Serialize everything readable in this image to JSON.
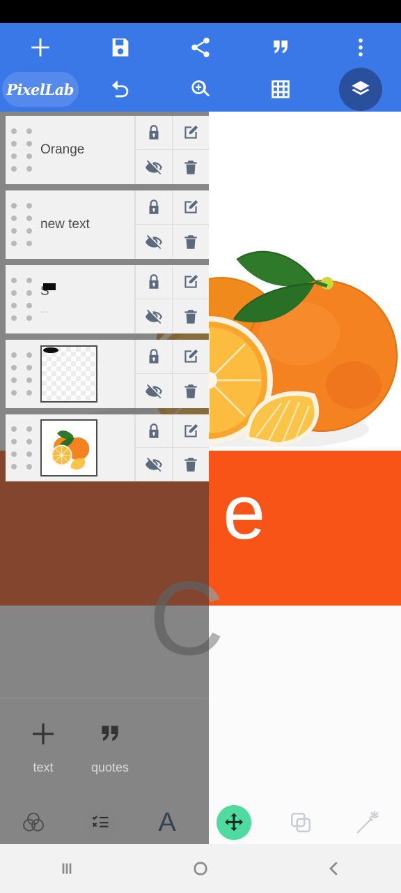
{
  "app": {
    "name": "PixelLab",
    "logo_text": "PixelLab"
  },
  "colors": {
    "appbar_blue": "#3b78e7",
    "logo_pill_blue": "#5689ec",
    "layers_fab_navy": "#2a4f9b",
    "canvas_orange": "#f95418",
    "panel_overlay": "rgba(60,60,60,0.62)",
    "accent_green": "#4fdba0",
    "letter_a_blue": "#2b4a7d"
  },
  "appbar": {
    "row1": [
      {
        "name": "add",
        "icon": "plus-icon",
        "label": "+"
      },
      {
        "name": "save",
        "icon": "save-disk-icon",
        "label": ""
      },
      {
        "name": "share",
        "icon": "share-icon",
        "label": ""
      },
      {
        "name": "quotes",
        "icon": "quote-icon",
        "label": ""
      },
      {
        "name": "overflow",
        "icon": "more-vertical-icon",
        "label": ""
      }
    ],
    "row2": [
      {
        "name": "logo",
        "icon": "pixellab-logo",
        "label": "PixelLab"
      },
      {
        "name": "undo",
        "icon": "undo-icon",
        "label": ""
      },
      {
        "name": "zoom",
        "icon": "zoom-in-icon",
        "label": ""
      },
      {
        "name": "grid",
        "icon": "grid-icon",
        "label": ""
      },
      {
        "name": "layers",
        "icon": "layers-stack-icon",
        "label": ""
      }
    ]
  },
  "layers": {
    "panel_title": "",
    "items": [
      {
        "name": "Orange",
        "subtitle": "",
        "type": "text",
        "thumb": "none",
        "actions": [
          "lock-icon",
          "edit-icon",
          "eye-off-icon",
          "trash-icon"
        ]
      },
      {
        "name": "new text",
        "subtitle": "",
        "type": "text",
        "thumb": "none",
        "actions": [
          "lock-icon",
          "edit-icon",
          "eye-off-icon",
          "trash-icon"
        ]
      },
      {
        "name": "S",
        "subtitle": "...",
        "type": "text",
        "thumb": "none",
        "actions": [
          "lock-icon",
          "edit-icon",
          "eye-off-icon",
          "trash-icon"
        ]
      },
      {
        "name": "",
        "subtitle": "",
        "type": "shape",
        "thumb": "transparent",
        "actions": [
          "lock-icon",
          "edit-icon",
          "eye-off-icon",
          "trash-icon"
        ]
      },
      {
        "name": "",
        "subtitle": "",
        "type": "image",
        "thumb": "oranges-photo",
        "actions": [
          "lock-icon",
          "edit-icon",
          "eye-off-icon",
          "trash-icon"
        ]
      }
    ]
  },
  "addbar": {
    "items": [
      {
        "icon": "plus-icon",
        "label": "text"
      },
      {
        "icon": "quote-icon",
        "label": "quotes"
      }
    ]
  },
  "canvas": {
    "text_fragment": "e",
    "ghost_fragment": "C",
    "image_alt": "oranges-photo"
  },
  "toolbar": {
    "items": [
      {
        "name": "blend",
        "icon": "venn-circles-icon",
        "selected": false
      },
      {
        "name": "layers-list",
        "icon": "checklist-icon",
        "selected": true
      },
      {
        "name": "text-tool",
        "icon": "letter-a-icon",
        "label": "A",
        "selected": false
      },
      {
        "name": "move-tool",
        "icon": "move-arrows-icon",
        "selected": true
      },
      {
        "name": "duplicate",
        "icon": "duplicate-icon",
        "selected": false
      },
      {
        "name": "magic-wand",
        "icon": "magic-wand-icon",
        "selected": false
      }
    ]
  },
  "navbar": {
    "items": [
      {
        "name": "recents",
        "icon": "recents-icon"
      },
      {
        "name": "home",
        "icon": "home-circle-icon"
      },
      {
        "name": "back",
        "icon": "back-chevron-icon"
      }
    ]
  }
}
